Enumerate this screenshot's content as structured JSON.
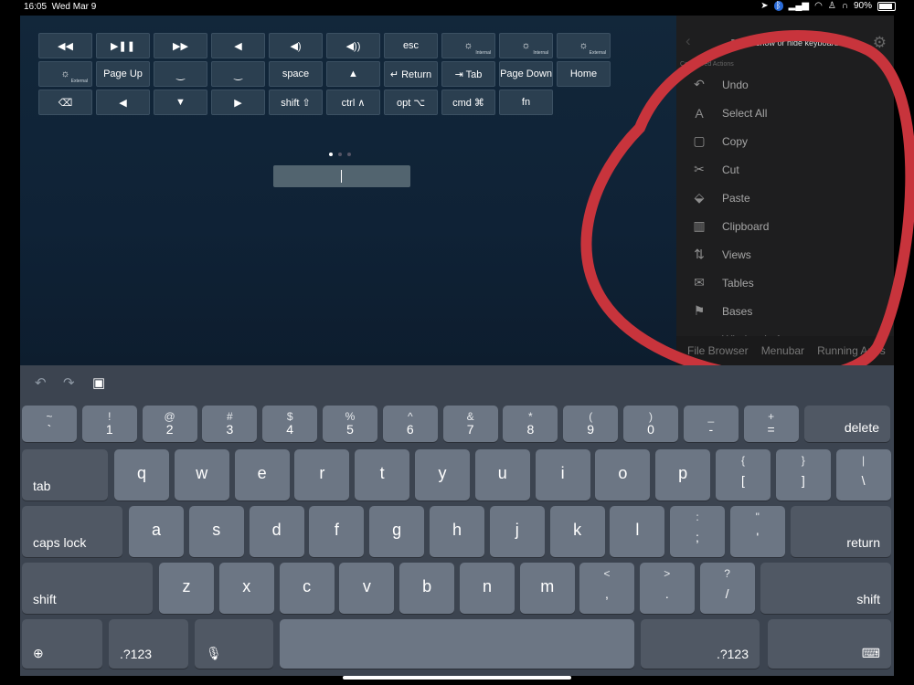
{
  "status": {
    "time": "16:05",
    "date": "Wed Mar 9",
    "battery": "90%"
  },
  "remote_keys": [
    {
      "label": "◀◀",
      "sub": ""
    },
    {
      "label": "▶❚❚",
      "sub": ""
    },
    {
      "label": "▶▶",
      "sub": ""
    },
    {
      "label": "◀",
      "sub": ""
    },
    {
      "label": "◀)",
      "sub": ""
    },
    {
      "label": "◀))",
      "sub": ""
    },
    {
      "label": "esc",
      "sub": ""
    },
    {
      "label": "☼",
      "sub": "Internal"
    },
    {
      "label": "☼",
      "sub": "Internal"
    },
    {
      "label": "☼",
      "sub": "External"
    },
    {
      "label": "☼",
      "sub": "External"
    },
    {
      "label": "Page Up",
      "sub": ""
    },
    {
      "label": "‿",
      "sub": ""
    },
    {
      "label": "‿",
      "sub": ""
    },
    {
      "label": "space",
      "sub": ""
    },
    {
      "label": "▲",
      "sub": ""
    },
    {
      "label": "↵ Return",
      "sub": ""
    },
    {
      "label": "⇥ Tab",
      "sub": ""
    },
    {
      "label": "Page Down",
      "sub": ""
    },
    {
      "label": "Home",
      "sub": ""
    },
    {
      "label": "⌫",
      "sub": ""
    },
    {
      "label": "◀",
      "sub": ""
    },
    {
      "label": "▼",
      "sub": ""
    },
    {
      "label": "▶",
      "sub": ""
    },
    {
      "label": "shift ⇧",
      "sub": ""
    },
    {
      "label": "ctrl ∧",
      "sub": ""
    },
    {
      "label": "opt ⌥",
      "sub": ""
    },
    {
      "label": "cmd ⌘",
      "sub": ""
    },
    {
      "label": "fn",
      "sub": ""
    }
  ],
  "panel": {
    "header": "Tap to show or hide keyboard",
    "section": "Configured Actions",
    "items": [
      {
        "icon": "↶",
        "label": "Undo"
      },
      {
        "icon": "A",
        "label": "Select All"
      },
      {
        "icon": "▢",
        "label": "Copy"
      },
      {
        "icon": "✂",
        "label": "Cut"
      },
      {
        "icon": "⬙",
        "label": "Paste"
      },
      {
        "icon": "▥",
        "label": "Clipboard"
      },
      {
        "icon": "⇅",
        "label": "Views"
      },
      {
        "icon": "✉",
        "label": "Tables"
      },
      {
        "icon": "⚑",
        "label": "Bases"
      },
      {
        "icon": "◐",
        "label": "Window Left"
      }
    ],
    "tabs": [
      "File Browser",
      "Menubar",
      "Running Apps"
    ]
  },
  "keyboard": {
    "row1": [
      [
        "~",
        "`"
      ],
      [
        "!",
        "1"
      ],
      [
        "@",
        "2"
      ],
      [
        "#",
        "3"
      ],
      [
        "$",
        "4"
      ],
      [
        "%",
        "5"
      ],
      [
        "^",
        "6"
      ],
      [
        "&",
        "7"
      ],
      [
        "*",
        "8"
      ],
      [
        "(",
        "9"
      ],
      [
        ")",
        "0"
      ],
      [
        "_",
        "-"
      ],
      [
        "+",
        "="
      ]
    ],
    "delete": "delete",
    "tab": "tab",
    "row2": [
      "q",
      "w",
      "e",
      "r",
      "t",
      "y",
      "u",
      "i",
      "o",
      "p"
    ],
    "row2sym": [
      [
        "{",
        "["
      ],
      [
        "}",
        "]"
      ],
      [
        "|",
        "\\"
      ]
    ],
    "caps": "caps lock",
    "row3": [
      "a",
      "s",
      "d",
      "f",
      "g",
      "h",
      "j",
      "k",
      "l"
    ],
    "row3sym": [
      [
        ":",
        ";"
      ],
      [
        "\"",
        "'"
      ]
    ],
    "return": "return",
    "shift": "shift",
    "row4": [
      "z",
      "x",
      "c",
      "v",
      "b",
      "n",
      "m"
    ],
    "row4sym": [
      [
        "<",
        ","
      ],
      [
        ">",
        "."
      ],
      [
        "?",
        "/"
      ]
    ],
    "num": ".?123"
  }
}
